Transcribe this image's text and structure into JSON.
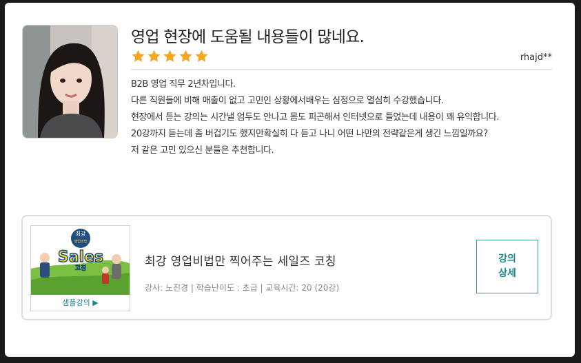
{
  "review": {
    "title": "영업 현장에 도움될 내용들이 많네요.",
    "rating": 5,
    "rating_max": 5,
    "author": "rhajd**",
    "lines": [
      "B2B 영업 직무 2년차입니다.",
      "다른 직원들에 비해 매출이 없고 고민인 상황에서배우는 심정으로 열심히 수강했습니다.",
      "현장에서 듣는 강의는 시간낼 엄두도 안나고 몸도 피곤해서 인터넷으로 들었는데 내용이 꽤 유익합니다.",
      "20강까지 듣는데 좀 버겁기도 했지만확실히 다 듣고 나니 어떤 나만의 전략같은게 생긴 느낌일까요?",
      "저 같은 고민 있으신 분들은 추천합니다."
    ]
  },
  "course": {
    "thumb_text": {
      "top": "최강",
      "sub": "영업비법",
      "main": "Sales",
      "bottom": "코칭"
    },
    "sample_label": "샘플강의 ▶",
    "title": "최강 영업비법만 찍어주는 세일즈 코칭",
    "meta": "강사: 노진경 | 학습난이도 : 초급 | 교육시간: 20 (20강)",
    "detail_button": [
      "강의",
      "상세"
    ]
  },
  "colors": {
    "star": "#f5a623",
    "accent": "#1a8a8a"
  }
}
